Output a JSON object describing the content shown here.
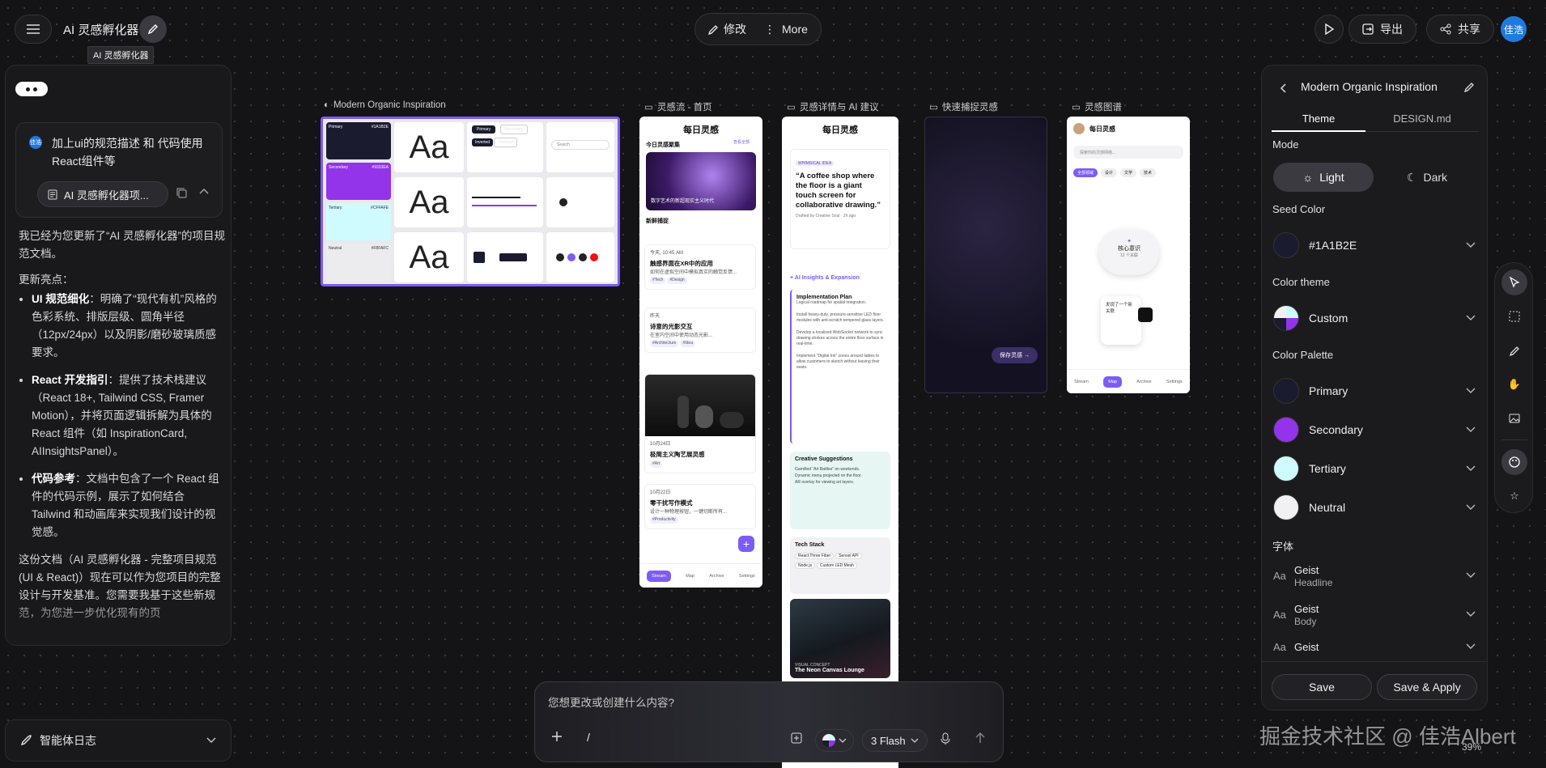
{
  "app": {
    "title": "AI 灵感孵化器",
    "tooltip": "AI 灵感孵化器",
    "avatar_label": "佳浩"
  },
  "toolbar": {
    "modify_label": "修改",
    "more_label": "More",
    "export_label": "导出",
    "share_label": "共享"
  },
  "chat": {
    "user_message": "加上ui的规范描述 和 代码使用React组件等",
    "doc_chip": "AI 灵感孵化器项...",
    "reply": {
      "intro": "我已经为您更新了“AI 灵感孵化器”的项目规范文档。",
      "highlights_title": "更新亮点：",
      "items": [
        {
          "bold": "UI 规范细化",
          "text": "：明确了“现代有机”风格的色彩系统、排版层级、圆角半径（12px/24px）以及阴影/磨砂玻璃质感要求。"
        },
        {
          "bold": "React 开发指引",
          "text": "：提供了技术栈建议（React 18+, Tailwind CSS, Framer Motion），并将页面逻辑拆解为具体的 React 组件（如 InspirationCard, AIInsightsPanel）。"
        },
        {
          "bold": "代码参考",
          "text": "：文档中包含了一个 React 组件的代码示例，展示了如何结合 Tailwind 和动画库来实现我们设计的视觉感。"
        }
      ],
      "outro": "这份文档（AI 灵感孵化器 - 完整项目规范 (UI & React)）现在可以作为您项目的完整设计与开发基准。您需要我基于这些新规范，为您进一步优化现有的页"
    },
    "agent_log_label": "智能体日志"
  },
  "frames": {
    "design": {
      "label": "Modern Organic Inspiration"
    },
    "stream": {
      "label": "灵感流 - 首页"
    },
    "detail": {
      "label": "灵感详情与 AI 建议"
    },
    "capture": {
      "label": "快速捕捉灵感"
    },
    "graph": {
      "label": "灵感图谱"
    }
  },
  "design_system": {
    "swatches": [
      {
        "name": "Primary",
        "hex": "#1A1B2E",
        "color": "#1a1b2e"
      },
      {
        "name": "Secondary",
        "hex": "#9333EA",
        "color": "#9333ea"
      },
      {
        "name": "Tertiary",
        "hex": "#CFFAFE",
        "color": "#cffafe"
      },
      {
        "name": "Neutral",
        "hex": "#F8FAFC",
        "color": "#ececef"
      }
    ],
    "type": [
      {
        "label": "Headline",
        "sample": "Aa"
      },
      {
        "label": "Body",
        "sample": "Aa"
      },
      {
        "label": "Label",
        "sample": "Aa"
      }
    ],
    "buttons": {
      "primary": "Primary",
      "secondary": "Secondary",
      "inverted": "Inverted",
      "outlined": "Outlined"
    },
    "search_ph": "Search"
  },
  "stream_screen": {
    "header": "每日灵感",
    "section1": "今日灵感聚集",
    "see_all": "查看全部",
    "hero_text": "数字艺术的新超现实主义时代",
    "section2": "新鲜捕捉",
    "cards": [
      {
        "meta": "今天, 10:45 AM",
        "title": "触感界面在XR中的应用",
        "body": "如何在虚拟空间中模拟真实的触觉反馈...",
        "tags": [
          "#Tech",
          "#Design"
        ]
      },
      {
        "meta": "昨天",
        "title": "诗意的光影交互",
        "body": "在室内空间中使用动态光影...",
        "tags": [
          "#Architecture",
          "#Idea"
        ]
      },
      {
        "meta": "10月24日",
        "title": "极简主义陶艺展灵感",
        "body": "",
        "tags": [
          "#Art"
        ]
      },
      {
        "meta": "10月22日",
        "title": "零干扰写作模式",
        "body": "设计一种物理按钮，一键切断所有...",
        "tags": [
          "#Productivity"
        ]
      }
    ],
    "nav": [
      "Stream",
      "Map",
      "Archive",
      "Settings"
    ]
  },
  "detail_screen": {
    "header": "每日灵感",
    "badge": "WHIMSICAL IDEA",
    "quote": "“A coffee shop where the floor is a giant touch screen for collaborative drawing.”",
    "author": "Drafted by Creative Soul · 2h ago",
    "insights_title": "+ AI Insights & Expansion",
    "plan_title": "Implementation Plan",
    "plan_sub": "Logical roadmap for spatial integration.",
    "plan_steps": [
      "Install heavy-duty, pressure-sensitive LED floor modules with anti-scratch tempered glass layers.",
      "Develop a localized WebSocket network to sync drawing strokes across the entire floor surface in real-time.",
      "Implement \"Digital Ink\" zones around tables to allow customers to sketch without leaving their seats."
    ],
    "suggest_title": "Creative Suggestions",
    "suggestions": [
      "Gamified \"Art Battles\" on weekends.",
      "Dynamic menu projected on the floor.",
      "AR overlay for viewing art layers."
    ],
    "stack_title": "Tech Stack",
    "stack": [
      "React Three Fiber",
      "Sensel API",
      "Node.js",
      "Custom LED Mesh"
    ],
    "visual_label": "VISUAL CONCEPT",
    "visual_title": "The Neon Canvas Lounge"
  },
  "capture_screen": {
    "save_label": "保存灵感 →"
  },
  "graph_screen": {
    "header": "每日灵感",
    "search_ph": "探索你的灵感网络...",
    "chips": [
      "全部领域",
      "设计",
      "文学",
      "技术"
    ],
    "core_label": "核心意识",
    "core_sub": "12 个关联",
    "node_text": "发现了一个新关联",
    "nav": [
      "Stream",
      "Map",
      "Archive",
      "Settings"
    ]
  },
  "theme_panel": {
    "title": "Modern Organic Inspiration",
    "tabs": [
      "Theme",
      "DESIGN.md"
    ],
    "mode_label": "Mode",
    "light_label": "Light",
    "dark_label": "Dark",
    "seed_label": "Seed Color",
    "seed_value": "#1A1B2E",
    "color_theme_label": "Color theme",
    "color_theme_value": "Custom",
    "palette_label": "Color Palette",
    "palette": [
      {
        "name": "Primary",
        "color": "#1a1b2e"
      },
      {
        "name": "Secondary",
        "color": "#9333ea"
      },
      {
        "name": "Tertiary",
        "color": "#cffafe"
      },
      {
        "name": "Neutral",
        "color": "#f1f1f3"
      }
    ],
    "fonts_label": "字体",
    "fonts": [
      {
        "name": "Geist",
        "role": "Headline"
      },
      {
        "name": "Geist",
        "role": "Body"
      },
      {
        "name": "Geist",
        "role": ""
      }
    ],
    "save_label": "Save",
    "save_apply_label": "Save & Apply"
  },
  "prompt": {
    "placeholder": "您想更改或创建什么内容?",
    "slash": "/",
    "model_label": "3 Flash"
  },
  "watermark": "掘金技术社区 @ 佳浩Albert",
  "zoom_label": "39%"
}
